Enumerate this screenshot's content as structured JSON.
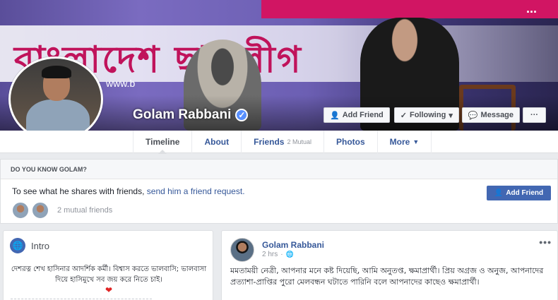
{
  "profile": {
    "name": "Golam Rabbani",
    "verified_icon": "verified-badge-icon"
  },
  "cover": {
    "banner_text": "বাংলাদেশ ছাত্রলীগ",
    "top_strip_text": "...",
    "url_fragment": "www.b"
  },
  "cover_buttons": {
    "add_friend": "Add Friend",
    "following": "Following",
    "message": "Message",
    "more": "···"
  },
  "tabs": [
    {
      "label": "Timeline"
    },
    {
      "label": "About"
    },
    {
      "label": "Friends",
      "sub": "2 Mutual"
    },
    {
      "label": "Photos"
    },
    {
      "label": "More"
    }
  ],
  "know_box": {
    "header": "DO YOU KNOW GOLAM?",
    "message_prefix": "To see what he shares with friends,",
    "message_link": "send him a friend request.",
    "mutual_friends": "2 mutual friends",
    "add_friend_button": "Add Friend"
  },
  "intro": {
    "title": "Intro",
    "bio": "দেশরত্ন শেখ হাসিনার আদর্শিক কর্মী। বিশ্বাস করতে ভালবাসি; ভালবাসা দিয়ে হাসিমুখে সব জয় করে নিতে চাই।",
    "heart": "❤"
  },
  "post": {
    "author": "Golam Rabbani",
    "time": "2 hrs",
    "privacy_icon": "globe-icon",
    "menu": "•••",
    "text": "মমতাময়ী নেত্রী, আপনার মনে কষ্ট দিয়েছি, আমি অনুতপ্ত, ক্ষমাপ্রার্থী। প্রিয় অগ্রজ ও অনুজ, আপনাদের প্রত্যাশা-প্রাপ্তির পুরো মেলবন্ধন ঘটাতে পারিনি বলে আপনাদের কাছেও ক্ষমাপ্রার্থী।"
  },
  "colors": {
    "brand_blue": "#4267b2",
    "link_blue": "#365899",
    "page_bg": "#e9ebee"
  }
}
